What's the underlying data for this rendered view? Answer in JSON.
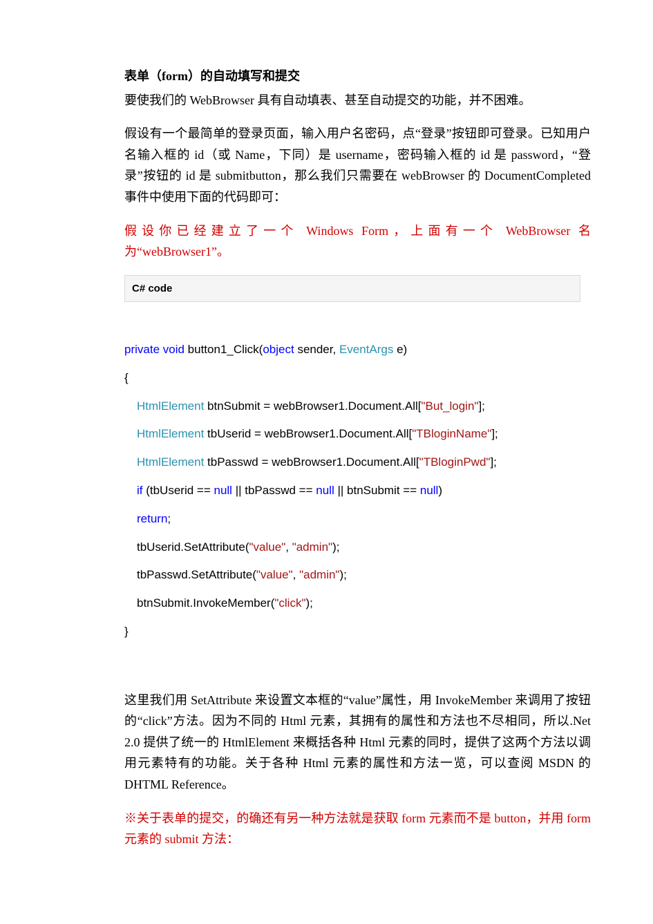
{
  "title": "表单（form）的自动填写和提交",
  "p1": "要使我们的 WebBrowser 具有自动填表、甚至自动提交的功能，并不困难。",
  "p2": "假设有一个最简单的登录页面，输入用户名密码，点“登录”按钮即可登录。已知用户名输入框的 id（或 Name，下同）是 username，密码输入框的 id 是 password，“登录”按钮的 id 是 submitbutton，那么我们只需要在 webBrowser 的 DocumentCompleted 事件中使用下面的代码即可：",
  "p3": "假设你已经建立了一个 Windows  Form，上面有一个 WebBrowser 名为“webBrowser1”。",
  "codeHeader": "C#   code",
  "code": {
    "sig_kw1": "private",
    "sig_kw2": "void",
    "sig_name": " button1_Click(",
    "sig_kw3": "object",
    "sig_mid": " sender, ",
    "sig_typ": "EventArgs",
    "sig_end": " e)",
    "brace_open": "{",
    "l1_typ": "HtmlElement",
    "l1_mid": " btnSubmit = webBrowser1.Document.All[",
    "l1_str": "\"But_login\"",
    "l1_end": "];",
    "l2_typ": "HtmlElement",
    "l2_mid": " tbUserid = webBrowser1.Document.All[",
    "l2_str": "\"TBloginName\"",
    "l2_end": "];",
    "l3_typ": "HtmlElement",
    "l3_mid": " tbPasswd = webBrowser1.Document.All[",
    "l3_str": "\"TBloginPwd\"",
    "l3_end": "];",
    "l4_kw": "if",
    "l4_rest": " (tbUserid == ",
    "l4_null1": "null",
    "l4_or1": " || tbPasswd == ",
    "l4_null2": "null",
    "l4_or2": " || btnSubmit == ",
    "l4_null3": "null",
    "l4_close": ")",
    "l5_kw": "return",
    "l5_end": ";",
    "l6_a": "tbUserid.SetAttribute(",
    "l6_s1": "\"value\"",
    "l6_c": ", ",
    "l6_s2": "\"admin\"",
    "l6_e": ");",
    "l7_a": "tbPasswd.SetAttribute(",
    "l7_s1": "\"value\"",
    "l7_c": ", ",
    "l7_s2": "\"admin\"",
    "l7_e": ");",
    "l8_a": "btnSubmit.InvokeMember(",
    "l8_s": "\"click\"",
    "l8_e": ");",
    "brace_close": "}"
  },
  "p4": "这里我们用 SetAttribute 来设置文本框的“value”属性，用 InvokeMember 来调用了按钮的“click”方法。因为不同的 Html 元素，其拥有的属性和方法也不尽相同，所以.Net  2.0 提供了统一的 HtmlElement 来概括各种 Html 元素的同时，提供了这两个方法以调用元素特有的功能。关于各种 Html 元素的属性和方法一览，可以查阅 MSDN 的 DHTML   Reference。",
  "p5": "※关于表单的提交，的确还有另一种方法就是获取 form 元素而不是 button，并用 form 元素的  submit 方法："
}
